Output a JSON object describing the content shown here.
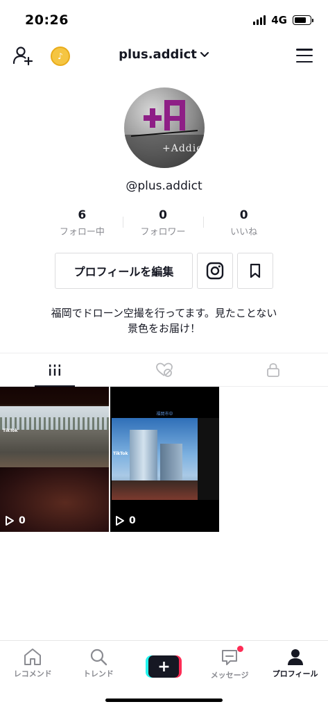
{
  "status_bar": {
    "time": "20:26",
    "network": "4G"
  },
  "header": {
    "username": "plus.addict"
  },
  "profile": {
    "avatar_text": "+Addict",
    "handle": "@plus.addict",
    "stats": [
      {
        "value": "6",
        "label": "フォロー中"
      },
      {
        "value": "0",
        "label": "フォロワー"
      },
      {
        "value": "0",
        "label": "いいね"
      }
    ],
    "edit_button_label": "プロフィールを編集",
    "bio_line1": "福岡でドローン空撮を行ってます。見たことない",
    "bio_line2": "景色をお届け！"
  },
  "videos": [
    {
      "views": "0",
      "badge": "TikTok"
    },
    {
      "views": "0",
      "badge": "TikTok",
      "caption": "福岡市中"
    }
  ],
  "bottom_nav": [
    {
      "label": "レコメンド",
      "icon": "home-icon"
    },
    {
      "label": "トレンド",
      "icon": "search-icon"
    },
    {
      "label": "",
      "icon": "create-plus-icon"
    },
    {
      "label": "メッセージ",
      "icon": "message-icon"
    },
    {
      "label": "プロフィール",
      "icon": "profile-icon"
    }
  ],
  "colors": {
    "accent_red": "#fe2c55",
    "accent_cyan": "#25f4ee",
    "text": "#161823",
    "muted": "#8a8b91"
  }
}
